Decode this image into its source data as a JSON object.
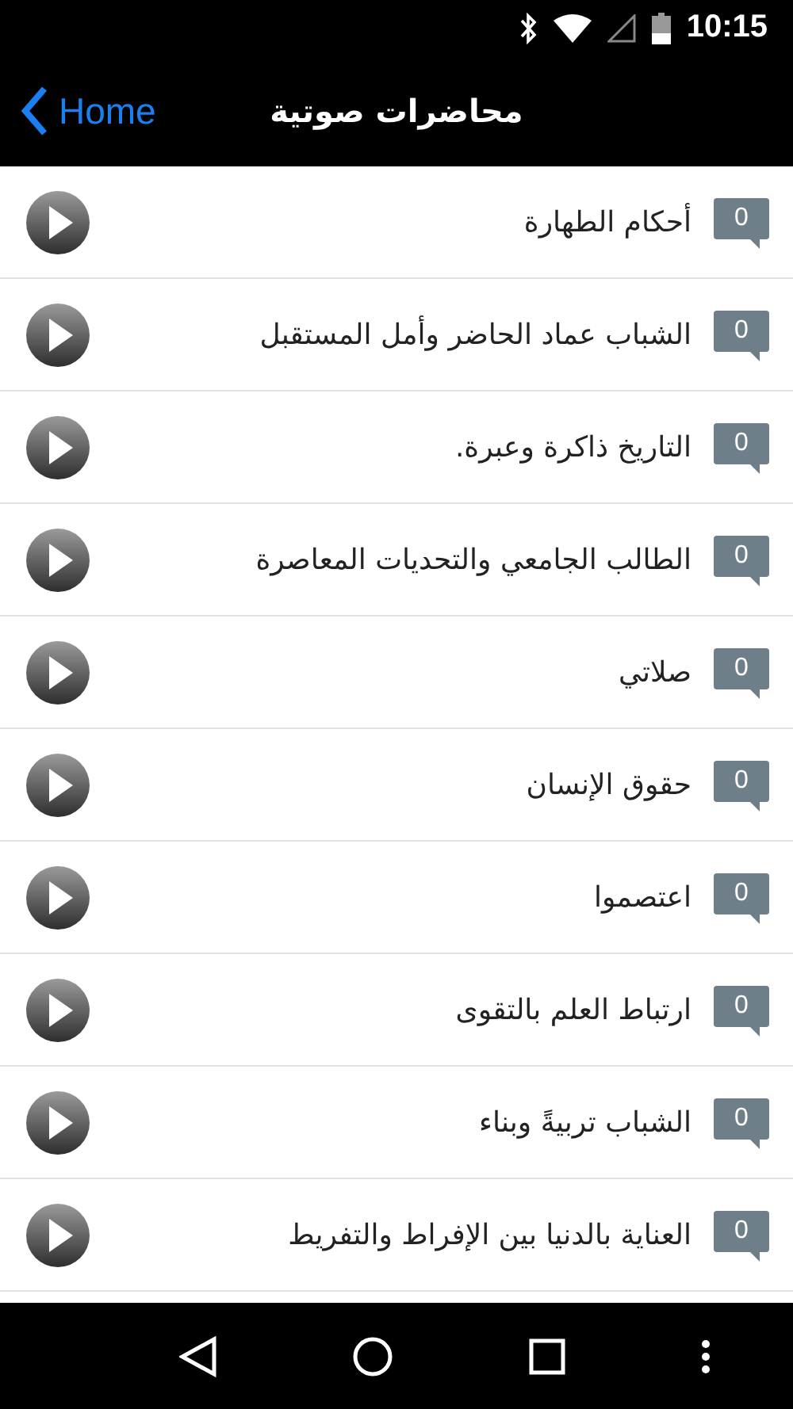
{
  "status_bar": {
    "time": "10:15"
  },
  "nav_bar": {
    "back_label": "Home",
    "title": "محاضرات صوتية"
  },
  "lectures": [
    {
      "title": "أحكام الطهارة",
      "count": "0"
    },
    {
      "title": "الشباب عماد الحاضر وأمل المستقبل",
      "count": "0"
    },
    {
      "title": "التاريخ ذاكرة وعبرة.",
      "count": "0"
    },
    {
      "title": "الطالب الجامعي والتحديات المعاصرة",
      "count": "0"
    },
    {
      "title": "صلاتي",
      "count": "0"
    },
    {
      "title": "حقوق الإنسان",
      "count": "0"
    },
    {
      "title": "اعتصموا",
      "count": "0"
    },
    {
      "title": "ارتباط العلم بالتقوى",
      "count": "0"
    },
    {
      "title": "الشباب تربيةً وبناء",
      "count": "0"
    },
    {
      "title": "العناية بالدنيا بين الإفراط والتفريط",
      "count": "0"
    }
  ]
}
